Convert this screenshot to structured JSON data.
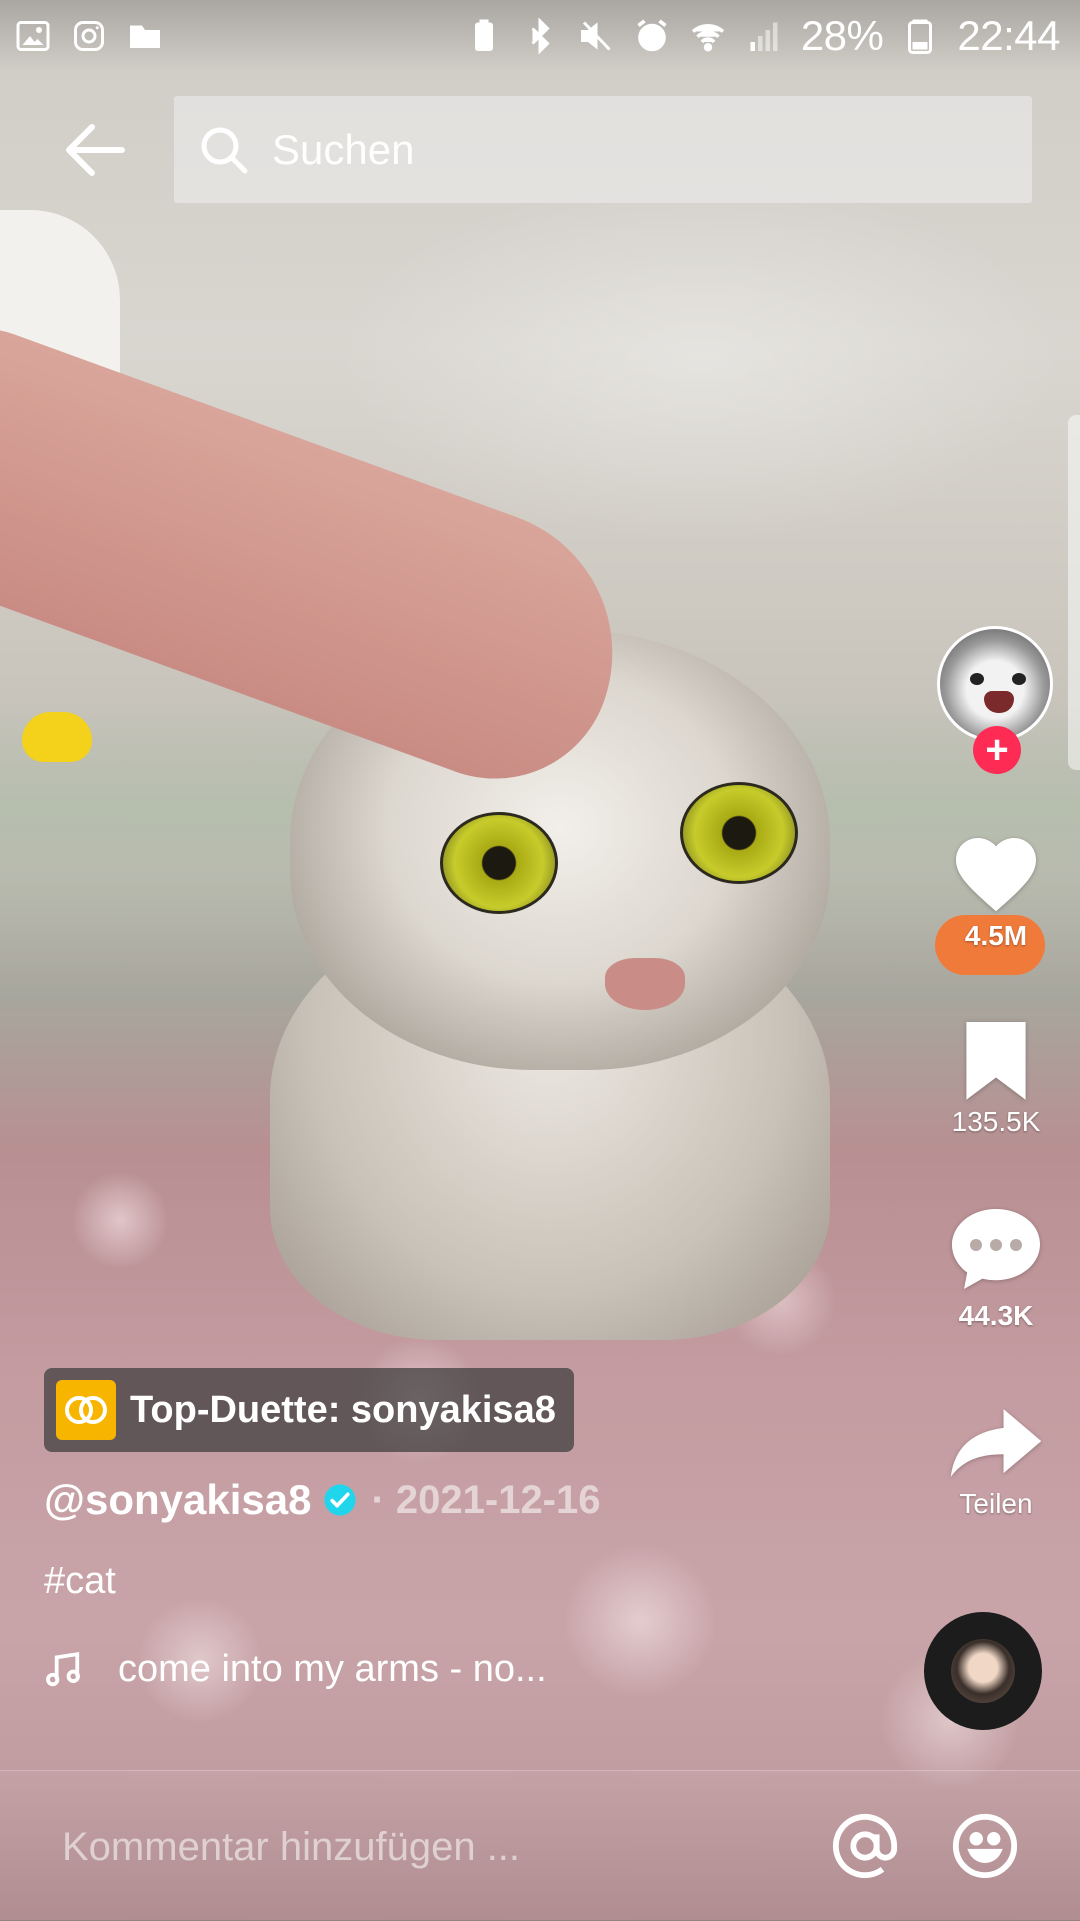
{
  "status_bar": {
    "battery_percent": "28%",
    "time": "22:44",
    "left_icons": [
      "gallery-icon",
      "instagram-icon",
      "folder-icon"
    ],
    "right_icons": [
      "battery-saver-icon",
      "bluetooth-icon",
      "mute-icon",
      "alarm-icon",
      "wifi-icon",
      "signal-icon",
      "battery-icon"
    ]
  },
  "header": {
    "search_placeholder": "Suchen"
  },
  "right_rail": {
    "likes": "4.5M",
    "saves": "135.5K",
    "comments": "44.3K",
    "share_label": "Teilen",
    "accent_color": "#fe2c55"
  },
  "post": {
    "duet_label": "Top-Duette: sonyakisa8",
    "author": "@sonyakisa8",
    "date": "· 2021-12-16",
    "hashtag": "#cat",
    "sound": "come into my arms - no..."
  },
  "comment_bar": {
    "placeholder": "Kommentar hinzufügen ..."
  }
}
